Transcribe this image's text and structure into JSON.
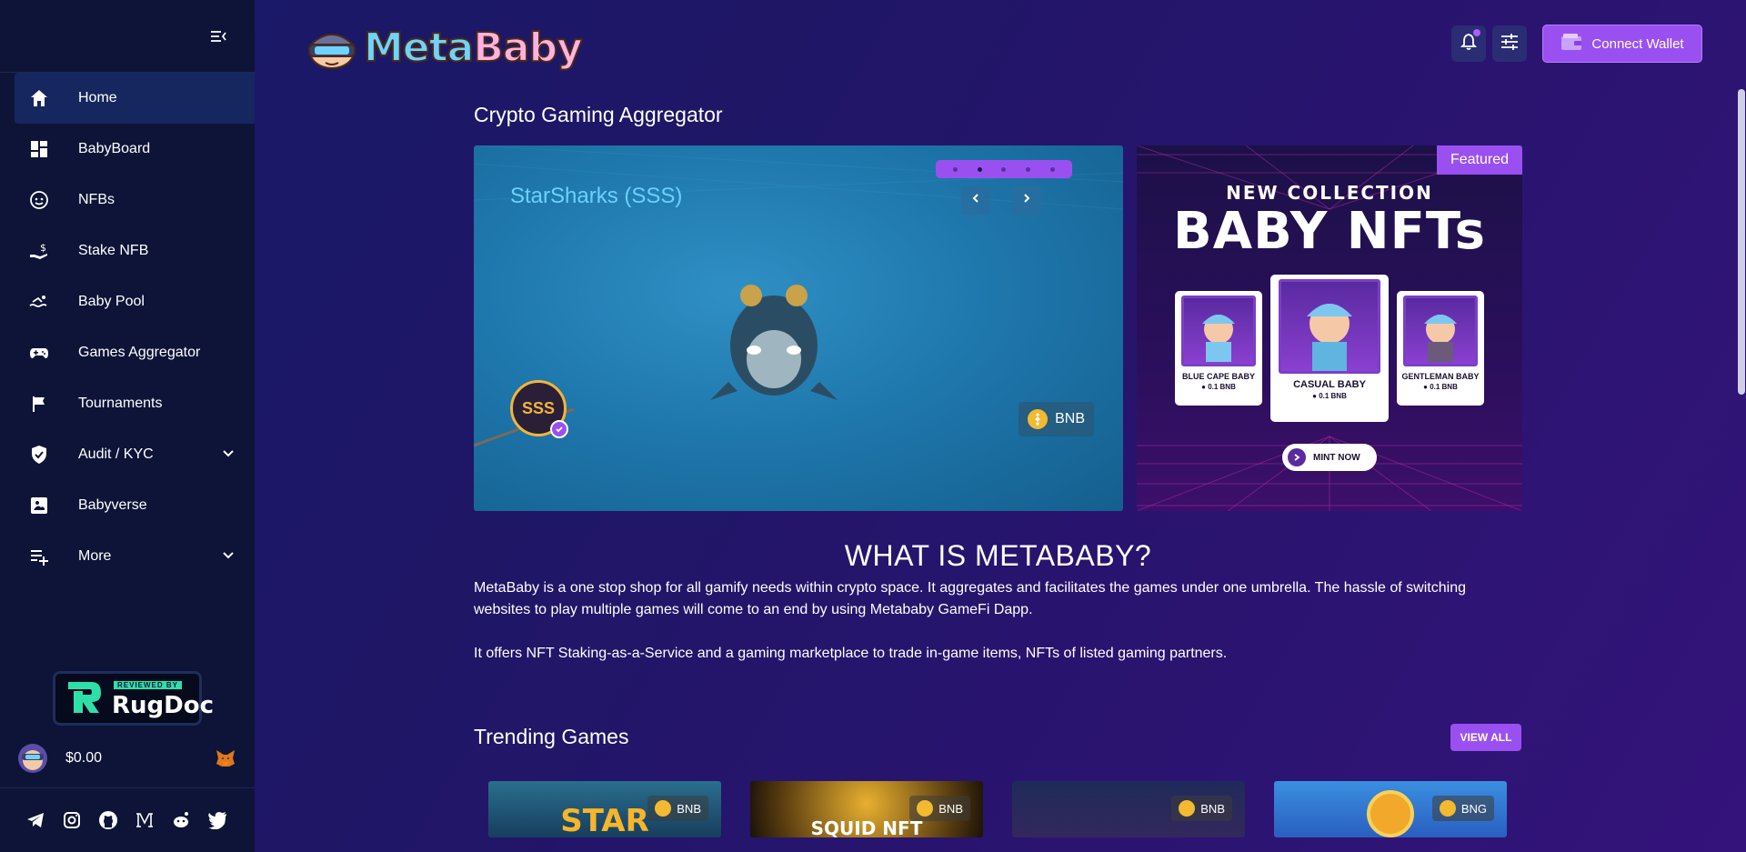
{
  "sidebar": {
    "items": [
      {
        "label": "Home",
        "icon": "home-icon",
        "active": true
      },
      {
        "label": "BabyBoard",
        "icon": "dashboard-icon"
      },
      {
        "label": "NFBs",
        "icon": "baby-face-icon"
      },
      {
        "label": "Stake NFB",
        "icon": "stake-hand-icon"
      },
      {
        "label": "Baby Pool",
        "icon": "swimmer-icon"
      },
      {
        "label": "Games Aggregator",
        "icon": "gamepad-icon"
      },
      {
        "label": "Tournaments",
        "icon": "flag-icon"
      },
      {
        "label": "Audit / KYC",
        "icon": "shield-check-icon",
        "expandable": true
      },
      {
        "label": "Babyverse",
        "icon": "babyverse-icon"
      },
      {
        "label": "More",
        "icon": "playlist-add-icon",
        "expandable": true
      }
    ],
    "rugdoc": {
      "ribbon": "REVIEWED BY",
      "name": "RugDoc"
    },
    "balance": "$0.00",
    "socials": [
      "telegram-icon",
      "instagram-icon",
      "github-icon",
      "medium-icon",
      "reddit-icon",
      "twitter-icon"
    ]
  },
  "header": {
    "logo_meta": "Meta",
    "logo_baby": "Baby",
    "connect_label": "Connect Wallet"
  },
  "main": {
    "title": "Crypto Gaming Aggregator",
    "hero": {
      "game_title": "StarSharks (SSS)",
      "chain": "BNB",
      "logo_text": "SSS"
    },
    "featured": {
      "badge": "Featured",
      "new_collection": "NEW COLLECTION",
      "headline": "BABY NFTs",
      "cards": [
        {
          "name": "BLUE CAPE BABY",
          "price": "0.1 BNB"
        },
        {
          "name": "CASUAL BABY",
          "price": "0.1 BNB"
        },
        {
          "name": "GENTLEMAN BABY",
          "price": "0.1 BNB"
        }
      ],
      "mint_label": "MINT NOW"
    },
    "what_title": "WHAT IS METABABY?",
    "what_p1": "MetaBaby is a one stop shop for all gamify needs within crypto space. It aggregates and facilitates the games under one umbrella. The hassle of switching websites to play multiple games will come to an end by using Metababy GameFi Dapp.",
    "what_p2": "It offers NFT Staking-as-a-Service and a gaming marketplace to trade in-game items, NFTs of listed gaming partners.",
    "trending_title": "Trending Games",
    "view_all": "VIEW ALL",
    "games": [
      {
        "chain": "BNB",
        "text": "STAR"
      },
      {
        "chain": "BNB",
        "text": "SQUID NFT"
      },
      {
        "chain": "BNB",
        "text": ""
      },
      {
        "chain": "BNG",
        "text": ""
      }
    ]
  },
  "colors": {
    "accent": "#9a50f0",
    "sidebar": "#0d1437",
    "bnb": "#f3ba2f"
  }
}
